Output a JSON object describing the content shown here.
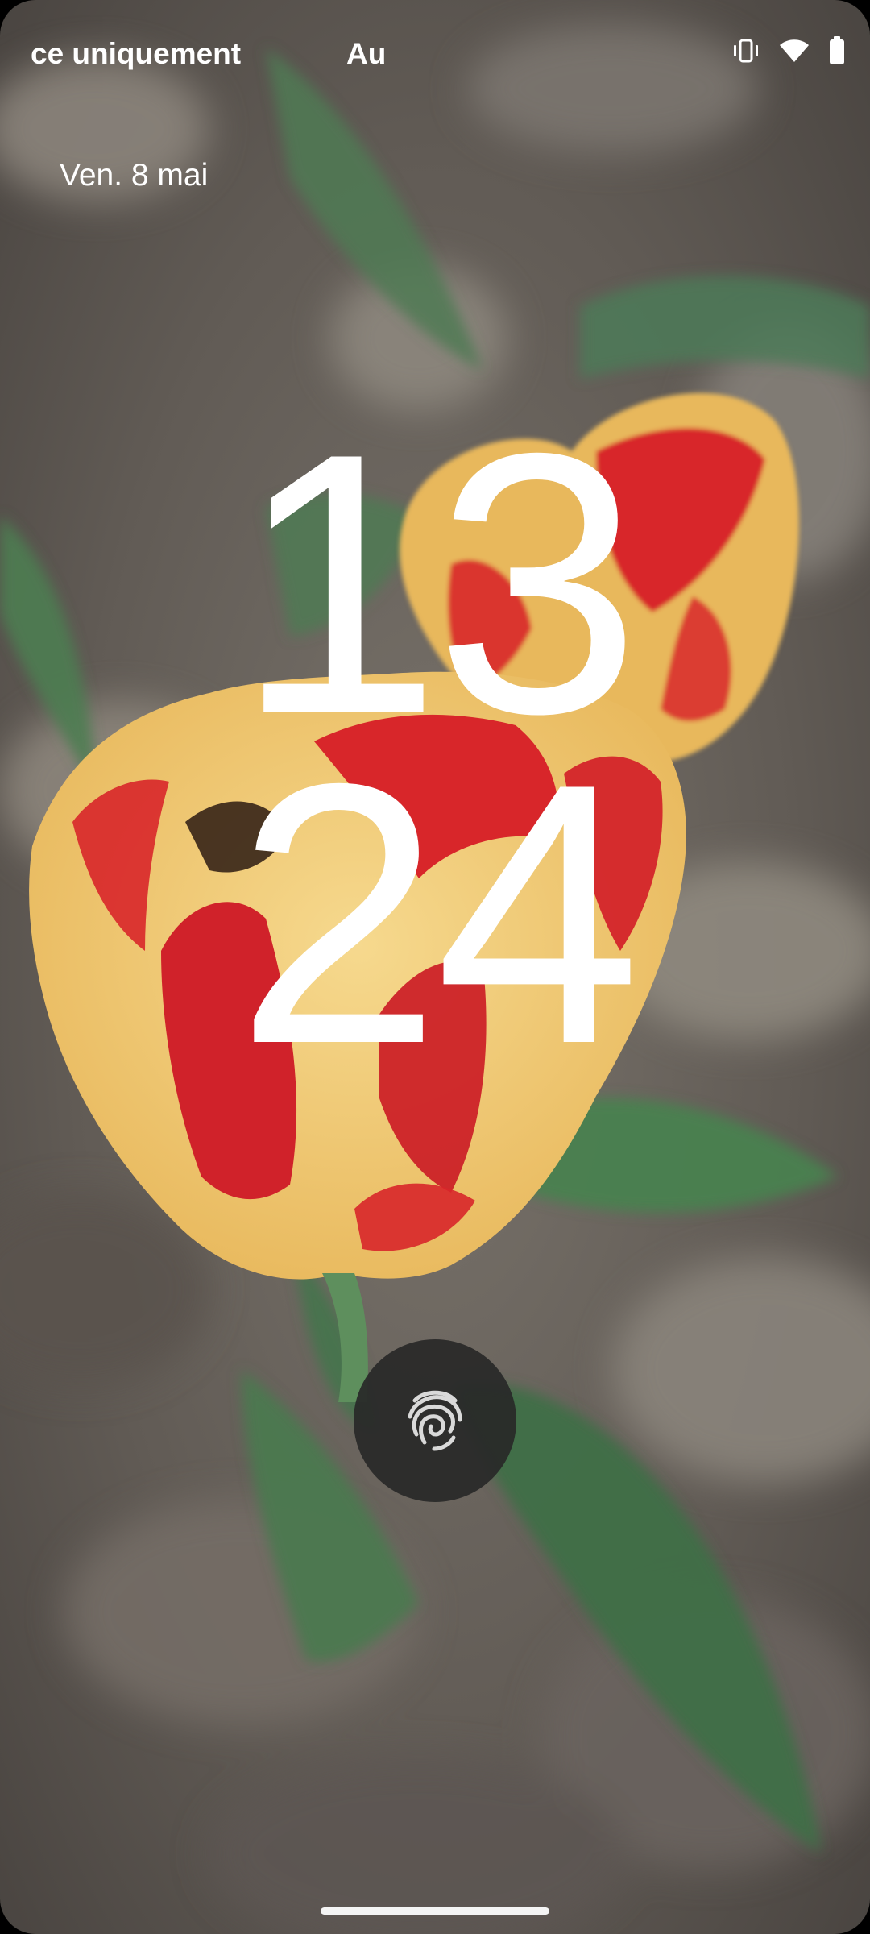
{
  "status_bar": {
    "carrier_left": "ce uniquement",
    "carrier_right": "Au",
    "icons": [
      "vibrate-icon",
      "wifi-icon",
      "battery-icon"
    ]
  },
  "lockscreen": {
    "date": "Ven. 8 mai",
    "clock_hours": "13",
    "clock_minutes": "24",
    "unlock_icon": "fingerprint-icon"
  },
  "wallpaper": {
    "subject": "tulips",
    "colors": {
      "background": "#6f6a63",
      "petal_red": "#d8262a",
      "petal_yellow": "#f1cf77",
      "leaf_green": "#4f7a54"
    }
  },
  "colors": {
    "text": "#ffffff",
    "fingerprint_button_bg": "#2a2a2a",
    "home_indicator": "#f4f4f4"
  }
}
